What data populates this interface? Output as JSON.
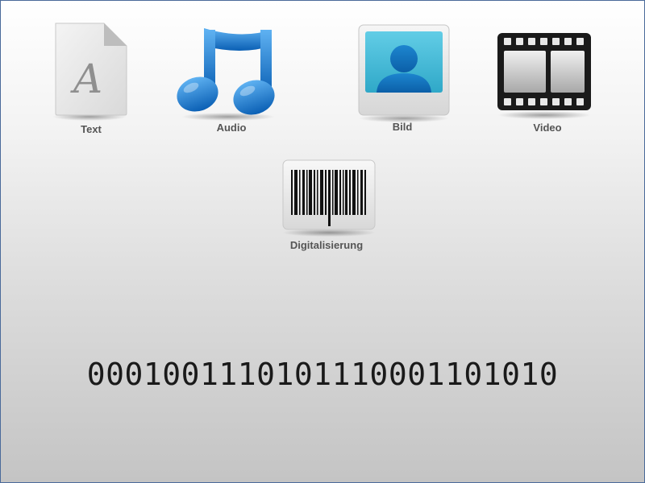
{
  "items": {
    "text": {
      "label": "Text",
      "icon": "text-document-icon"
    },
    "audio": {
      "label": "Audio",
      "icon": "music-note-icon"
    },
    "bild": {
      "label": "Bild",
      "icon": "person-image-icon"
    },
    "video": {
      "label": "Video",
      "icon": "film-strip-icon"
    },
    "digitalisierung": {
      "label": "Digitalisierung",
      "icon": "barcode-icon"
    }
  },
  "binary_string": "0001001110101110001101010",
  "colors": {
    "audio_blue": "#1e7fd6",
    "bild_cyan": "#2fb3d4",
    "label_gray": "#555555"
  }
}
